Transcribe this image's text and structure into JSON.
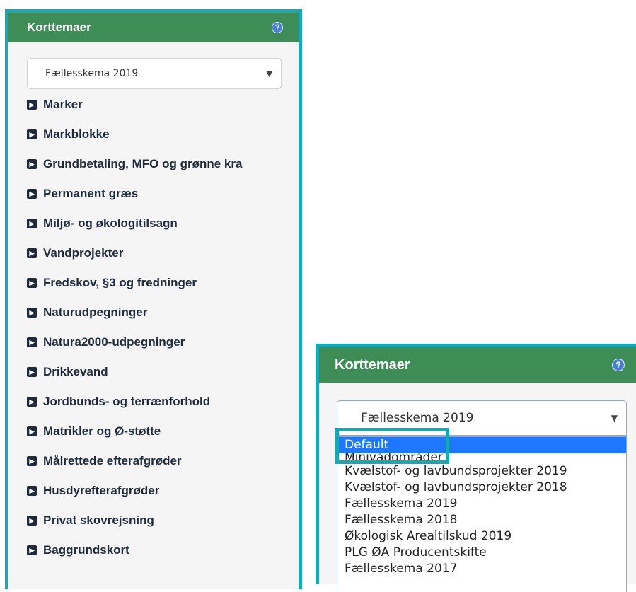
{
  "left_panel": {
    "title": "Korttemaer",
    "help_icon": "question-circle-icon",
    "select_value": "Fællesskema 2019",
    "items": [
      {
        "label": "Marker"
      },
      {
        "label": "Markblokke"
      },
      {
        "label": "Grundbetaling, MFO og grønne kra"
      },
      {
        "label": "Permanent græs"
      },
      {
        "label": "Miljø- og økologitilsagn"
      },
      {
        "label": "Vandprojekter"
      },
      {
        "label": "Fredskov, §3 og fredninger"
      },
      {
        "label": "Naturudpegninger"
      },
      {
        "label": "Natura2000-udpegninger"
      },
      {
        "label": "Drikkevand"
      },
      {
        "label": "Jordbunds- og terrænforhold"
      },
      {
        "label": "Matrikler og Ø-støtte"
      },
      {
        "label": "Målrettede efterafgrøder"
      },
      {
        "label": "Husdyrefterafgrøder"
      },
      {
        "label": "Privat skovrejsning"
      },
      {
        "label": "Baggrundskort"
      }
    ]
  },
  "right_panel": {
    "title": "Korttemaer",
    "help_icon": "question-circle-icon",
    "select_value": "Fællesskema 2019",
    "options": [
      {
        "label": "Default"
      },
      {
        "label": "Minivådområder"
      },
      {
        "label": "Kvælstof- og lavbundsprojekter 2019"
      },
      {
        "label": "Kvælstof- og lavbundsprojekter 2018"
      },
      {
        "label": "Fællesskema 2019"
      },
      {
        "label": "Fællesskema 2018"
      },
      {
        "label": "Økologisk Arealtilskud 2019"
      },
      {
        "label": "PLG ØA Producentskifte"
      },
      {
        "label": "Fællesskema 2017"
      }
    ],
    "selected_option": "Default"
  },
  "colors": {
    "header_green": "#3e8d57",
    "highlight_teal": "#16a9b5",
    "selected_blue": "#1e78ff",
    "item_text": "#1f2b3a",
    "panel_bg": "#f5f5f5"
  }
}
